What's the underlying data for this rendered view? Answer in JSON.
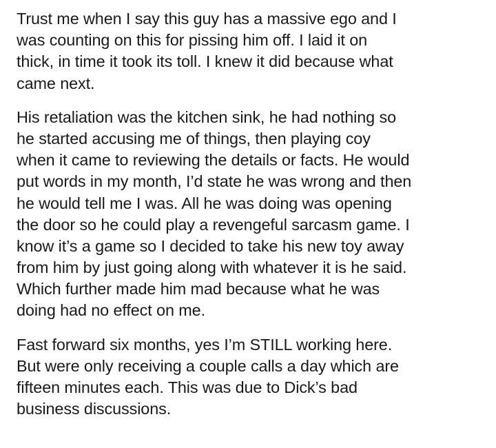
{
  "document": {
    "paragraphs": [
      {
        "lines": [
          "Trust me when I say this guy has a massive ego and I",
          "was counting on this for pissing him off.  I laid it on",
          "thick, in time it took its toll.  I knew it did because what",
          "came next."
        ]
      },
      {
        "lines": [
          "His retaliation was the kitchen sink, he had nothing so",
          "he started accusing me of things, then playing coy",
          "when it came to reviewing the details or facts. He would",
          "put words in my month, I’d state he was wrong and then",
          "he would tell me I was. All he was doing was opening",
          "the door so he could play a revengeful sarcasm game. I",
          "know it’s a game so I decided to take his new toy away",
          "from him by just going along with whatever it is he said.",
          "Which further made him mad because what he was",
          "doing had no effect on me."
        ]
      },
      {
        "lines": [
          "Fast forward six months, yes I’m STILL working here.",
          "But were only receiving a couple calls a day which are",
          "fifteen minutes each. This was due to Dick’s bad",
          "business discussions."
        ]
      }
    ]
  }
}
